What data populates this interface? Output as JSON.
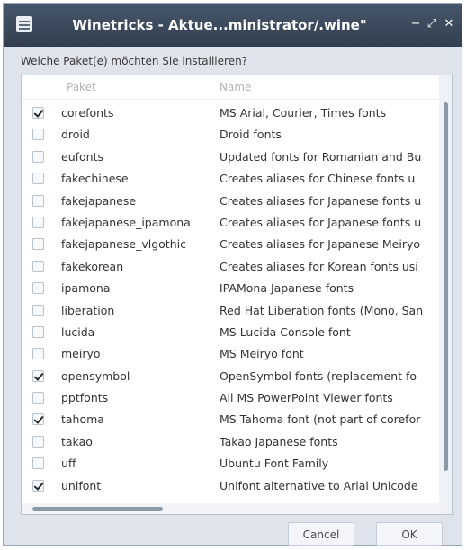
{
  "window": {
    "title": "Winetricks - Aktue...ministrator/.wine\"",
    "controls": {
      "minimize": "−",
      "maximize": "⤢",
      "close": "✕"
    }
  },
  "prompt": "Welche Paket(e) möchten Sie installieren?",
  "columns": {
    "paket": "Paket",
    "name": "Name"
  },
  "packages": [
    {
      "paket": "corefonts",
      "name": "MS Arial, Courier, Times fonts",
      "checked": true
    },
    {
      "paket": "droid",
      "name": "Droid fonts",
      "checked": false
    },
    {
      "paket": "eufonts",
      "name": "Updated fonts for Romanian and Bu",
      "checked": false
    },
    {
      "paket": "fakechinese",
      "name": "Creates aliases for Chinese fonts u",
      "checked": false
    },
    {
      "paket": "fakejapanese",
      "name": "Creates aliases for Japanese fonts u",
      "checked": false
    },
    {
      "paket": "fakejapanese_ipamona",
      "name": "Creates aliases for Japanese fonts u",
      "checked": false
    },
    {
      "paket": "fakejapanese_vlgothic",
      "name": "Creates aliases for Japanese Meiryo",
      "checked": false
    },
    {
      "paket": "fakekorean",
      "name": "Creates aliases for Korean fonts usi",
      "checked": false
    },
    {
      "paket": "ipamona",
      "name": "IPAMona Japanese fonts",
      "checked": false
    },
    {
      "paket": "liberation",
      "name": "Red Hat Liberation fonts (Mono, San",
      "checked": false
    },
    {
      "paket": "lucida",
      "name": "MS Lucida Console font",
      "checked": false
    },
    {
      "paket": "meiryo",
      "name": "MS Meiryo font",
      "checked": false
    },
    {
      "paket": "opensymbol",
      "name": "OpenSymbol fonts (replacement fo",
      "checked": true
    },
    {
      "paket": "pptfonts",
      "name": "All MS PowerPoint Viewer fonts",
      "checked": false
    },
    {
      "paket": "tahoma",
      "name": "MS Tahoma font (not part of corefor",
      "checked": true
    },
    {
      "paket": "takao",
      "name": "Takao Japanese fonts",
      "checked": false
    },
    {
      "paket": "uff",
      "name": "Ubuntu Font Family",
      "checked": false
    },
    {
      "paket": "unifont",
      "name": "Unifont alternative to Arial Unicode",
      "checked": true
    }
  ],
  "buttons": {
    "cancel": "Cancel",
    "ok": "OK"
  }
}
